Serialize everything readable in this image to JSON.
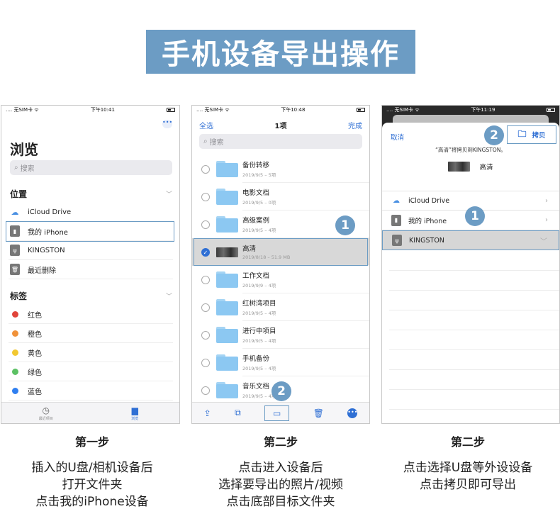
{
  "banner": {
    "title": "手机设备导出操作"
  },
  "phone1": {
    "status_left": "…. 无SIM卡 ᯤ",
    "status_time": "下午10:41",
    "more": "•••",
    "title": "浏览",
    "search_placeholder": "搜索",
    "locations_header": "位置",
    "locations": [
      {
        "label": "iCloud Drive",
        "icon": "cloud-icon"
      },
      {
        "label": "我的 iPhone",
        "icon": "phone-icon"
      },
      {
        "label": "KINGSTON",
        "icon": "usb-icon"
      },
      {
        "label": "最近删除",
        "icon": "trash-icon"
      }
    ],
    "tags_header": "标签",
    "tags": [
      {
        "label": "红色",
        "color": "#e0443a"
      },
      {
        "label": "橙色",
        "color": "#f0923a"
      },
      {
        "label": "黄色",
        "color": "#f2c831"
      },
      {
        "label": "绿色",
        "color": "#5cc164"
      },
      {
        "label": "蓝色",
        "color": "#2f7ff0"
      }
    ],
    "tab_recent": "最近项目",
    "tab_browse": "浏览"
  },
  "phone2": {
    "status_left": "…. 无SIM卡 ᯤ",
    "status_time": "下午10:48",
    "select_all": "全选",
    "title": "1项",
    "done": "完成",
    "search_placeholder": "搜索",
    "items": [
      {
        "name": "备份转移",
        "meta": "2019/9/5 – 5项",
        "type": "folder",
        "selected": false
      },
      {
        "name": "电影文档",
        "meta": "2019/9/5 – 0项",
        "type": "folder",
        "selected": false
      },
      {
        "name": "高级案例",
        "meta": "2019/9/5 – 4项",
        "type": "folder",
        "selected": false
      },
      {
        "name": "高清",
        "meta": "2019/8/18 – 51.9 MB",
        "type": "video",
        "selected": true
      },
      {
        "name": "工作文档",
        "meta": "2019/9/9 – 4项",
        "type": "folder",
        "selected": false
      },
      {
        "name": "红树湾项目",
        "meta": "2019/9/5 – 4项",
        "type": "folder",
        "selected": false
      },
      {
        "name": "进行中项目",
        "meta": "2019/9/5 – 4项",
        "type": "folder",
        "selected": false
      },
      {
        "name": "手机备份",
        "meta": "2019/9/5 – 4项",
        "type": "folder",
        "selected": false
      },
      {
        "name": "音乐文档",
        "meta": "2019/9/5 – 4项",
        "type": "folder",
        "selected": false
      }
    ],
    "badge1": "1",
    "badge2": "2"
  },
  "phone3": {
    "status_left": "…. 无SIM卡 ᯤ",
    "status_time": "下午11:19",
    "cancel": "取消",
    "copy": "拷贝",
    "note": "“高清”将拷贝到KINGSTON。",
    "preview_name": "高清",
    "locations": [
      {
        "label": "iCloud Drive",
        "icon": "cloud-icon"
      },
      {
        "label": "我的 iPhone",
        "icon": "phone-icon"
      },
      {
        "label": "KINGSTON",
        "icon": "usb-icon"
      }
    ],
    "badge1": "1",
    "badge2": "2"
  },
  "captions": [
    {
      "title": "第一步",
      "lines": [
        "插入的U盘/相机设备后",
        "打开文件夹",
        "点击我的iPhone设备"
      ]
    },
    {
      "title": "第二步",
      "lines": [
        "点击进入设备后",
        "选择要导出的照片/视频",
        "点击底部目标文件夹"
      ]
    },
    {
      "title": "第二步",
      "lines": [
        "点击选择U盘等外设设备",
        "点击拷贝即可导出"
      ]
    }
  ]
}
